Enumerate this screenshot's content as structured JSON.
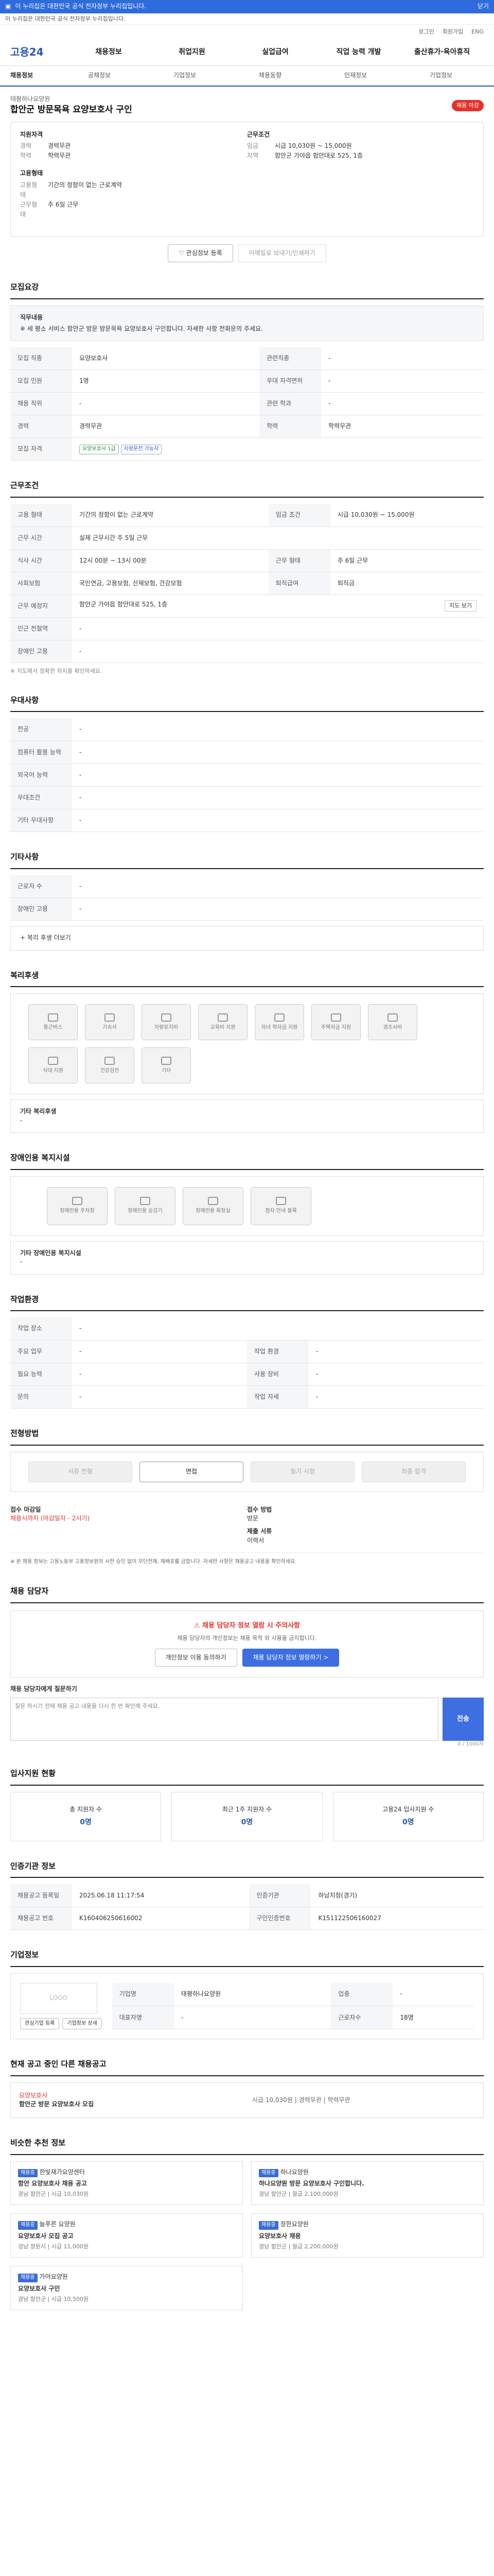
{
  "topbar": {
    "text": "이 누리집은 대한민국 공식 전자정부 누리집입니다.",
    "close": "닫기"
  },
  "gov": {
    "text": "이 누리집은 대한민국 공식 전자정부 누리집입니다."
  },
  "util": [
    "로그인",
    "회원가입",
    "ENG"
  ],
  "logo": "고용24",
  "gnb": [
    "채용정보",
    "취업지원",
    "실업급여",
    "직업 능력 개발",
    "출산휴가·육아휴직"
  ],
  "sub": [
    "채용정보",
    "공채정보",
    "기업정보",
    "채용동향",
    "인재정보",
    "기업정보"
  ],
  "job": {
    "company": "태평하나요양원",
    "title": "합안군 방문목욕 요양보호사 구인",
    "badge": "채용 마감"
  },
  "summary": {
    "left": [
      {
        "h": "지원자격",
        "rows": [
          [
            "경력",
            "경력무관"
          ],
          [
            "학력",
            "학력무관"
          ]
        ]
      },
      {
        "h": "고용형태",
        "rows": [
          [
            "고용형태",
            "기간의 정함이 없는 근로계약"
          ],
          [
            "근무형태",
            "주 6일 근무"
          ]
        ]
      }
    ],
    "right": [
      {
        "h": "근무조건",
        "rows": [
          [
            "임금",
            "시급 10,030원 ~ 15,000원"
          ],
          [
            "지역",
            "함안군 가야읍 함안대로 525, 1층"
          ]
        ]
      }
    ]
  },
  "buttons": {
    "apply": "관심정보 등록",
    "later": "이메일로 보내기/인쇄하기"
  },
  "s1": {
    "h": "모집요강",
    "box_t": "직무내용",
    "box_d": "※ 세 평소 서비스 함안군 방문 방문목욕 요양보호사 구인합니다. 자세한 사항 전화문의 주세요.",
    "rows": [
      [
        "모집 직종",
        "요양보호사",
        "관련직종",
        "-"
      ],
      [
        "모집 인원",
        "1명",
        "우대 자격면허",
        "-"
      ],
      [
        "채용 직위",
        "-",
        "관련 학과",
        "-"
      ],
      [
        "경력",
        "경력무관",
        "학력",
        "학력무관"
      ],
      [
        "모집 자격",
        "요양보호사 1급",
        "",
        ""
      ]
    ],
    "pills": [
      "요양보호사 1급",
      "차량운전 가능자"
    ]
  },
  "s2": {
    "h": "근무조건",
    "rows": [
      [
        "고용 형태",
        "기간의 정함이 없는 근로계약",
        "임금 조건",
        "시급 10,030원 ~ 15,000원"
      ],
      [
        "근무 시간",
        "실제 근무시간 주 5일 근무",
        "",
        ""
      ],
      [
        "식사 시간",
        "12시 00분 ~ 13시 00분",
        "근무 형태",
        "주 6일 근무"
      ],
      [
        "사회보험",
        "국민연금, 고용보험, 산재보험, 건강보험",
        "퇴직급여",
        "퇴직금"
      ],
      [
        "근무 예정지",
        "함안군 가야읍 함안대로 525, 1층",
        "",
        ""
      ],
      [
        "인근 전철역",
        "-",
        "",
        ""
      ],
      [
        "장애인 고용",
        "-",
        "",
        ""
      ]
    ],
    "map": "지도 보기",
    "note": "※ 지도에서 정확한 위치를 확인하세요."
  },
  "s3": {
    "h": "우대사항",
    "rows": [
      [
        "전공",
        "-"
      ],
      [
        "컴퓨터 활용 능력",
        "-"
      ],
      [
        "외국어 능력",
        "-"
      ],
      [
        "우대조건",
        "-"
      ],
      [
        "기타 우대사항",
        "-"
      ]
    ]
  },
  "s4": {
    "h": "기타사항",
    "rows": [
      [
        "근로자 수",
        "-"
      ],
      [
        "장애인 고용",
        "-"
      ]
    ],
    "more": "+ 복리 후생 더보기"
  },
  "s5": {
    "h": "복리후생",
    "items": [
      "통근버스",
      "기숙사",
      "차량유지비",
      "교육비 지원",
      "자녀 학자금 지원",
      "주택자금 지원",
      "경조사비",
      "식대 지원",
      "건강검진",
      "기타"
    ],
    "etc_t": "기타 복리후생",
    "etc": "-"
  },
  "s6": {
    "h": "장애인용 복지시설",
    "items": [
      "장애인용 주차장",
      "장애인용 승강기",
      "장애인용 화장실",
      "점자 안내 블록"
    ],
    "etc_t": "기타 장애인용 복지시설",
    "etc": "-"
  },
  "s7": {
    "h": "작업환경",
    "rows": [
      [
        "작업 장소",
        "-",
        "",
        ""
      ],
      [
        "주요 업무",
        "-",
        "작업 환경",
        "-"
      ],
      [
        "필요 능력",
        "-",
        "사용 장비",
        "-"
      ],
      [
        "문의",
        "-",
        "작업 자세",
        "-"
      ]
    ]
  },
  "s8": {
    "h": "전형방법",
    "steps": [
      "서류 전형",
      "면접",
      "필기 시험",
      "최종 합격"
    ],
    "apply": {
      "k1": "접수 마감일",
      "v1": "채용시까지 (마감일자 - 2시기)",
      "k2": "접수 방법",
      "v2": "방문",
      "k3": "제출 서류",
      "v3": "이력서"
    },
    "notes": "※ 본 채용 정보는 고용노동부 고용정보원의 사전 승인 없이 무단전재, 재배포를 금합니다. 자세한 사항은 채용공고 내용을 확인하세요."
  },
  "s9": {
    "h": "채용 담당자",
    "warn": "채용 담당자 정보 열람 시 주의사항",
    "p": "채용 담당자의 개인정보는 채용 목적 외 사용을 금지합니다.",
    "b1": "개인정보 이용 동의하기",
    "b2": "채용 담당자 정보 열람하기 >",
    "q": "채용 담당자에게 질문하기",
    "ph": "질문 하시기 전에 채용 공고 내용을 다시 한 번 확인해 주세요.",
    "send": "전송",
    "cnt": "0 / 1000자"
  },
  "s10": {
    "h": "입사지원 현황",
    "stats": [
      [
        "총 지원자 수",
        "0명"
      ],
      [
        "최근 1주 지원자 수",
        "0명"
      ],
      [
        "고용24 입사지원 수",
        "0명"
      ]
    ]
  },
  "s11": {
    "h": "인증기관 정보",
    "rows": [
      [
        "채용공고 등록일",
        "2025.06.18 11:17:54",
        "인증기관",
        "하남지청(경기)"
      ],
      [
        "채용공고 번호",
        "K160406250616002",
        "구인인증번호",
        "K151122506160027"
      ]
    ]
  },
  "s12": {
    "h": "기업정보",
    "rows": [
      [
        "기업명",
        "태평하나요양원",
        "업종",
        "-"
      ],
      [
        "대표자명",
        "-",
        "근로자수",
        "18명"
      ]
    ],
    "btns": [
      "관심기업 등록",
      "기업정보 상세"
    ]
  },
  "s13": {
    "h": "현재 공고 중인 다른 채용공고",
    "t": "요양보호사",
    "sub": "함안군 방문 요양보호사 모집",
    "info": "시급 10,030원 | 경력무관 | 학력무관"
  },
  "s14": {
    "h": "비슷한 추천 정보",
    "cards": [
      {
        "tag": "채용중",
        "co": "한빛재가요양센터",
        "t": "함안 요양보호사 채용 공고",
        "d": "경남 함안군 | 시급 10,030원"
      },
      {
        "tag": "채용중",
        "co": "하나요양원",
        "t": "하나요양원 방문 요양보호사 구인합니다.",
        "d": "경남 함안군 | 월급 2,100,000원"
      },
      {
        "tag": "채용중",
        "co": "늘푸른 요양원",
        "t": "요양보호사 모집 공고",
        "d": "경남 창원시 | 시급 11,000원"
      },
      {
        "tag": "채용중",
        "co": "정한요양원",
        "t": "요양보호사 채용",
        "d": "경남 함안군 | 월급 2,200,000원"
      },
      {
        "tag": "채용중",
        "co": "가야요양원",
        "t": "요양보호사 구인",
        "d": "경남 함안군 | 시급 10,500원"
      }
    ]
  }
}
